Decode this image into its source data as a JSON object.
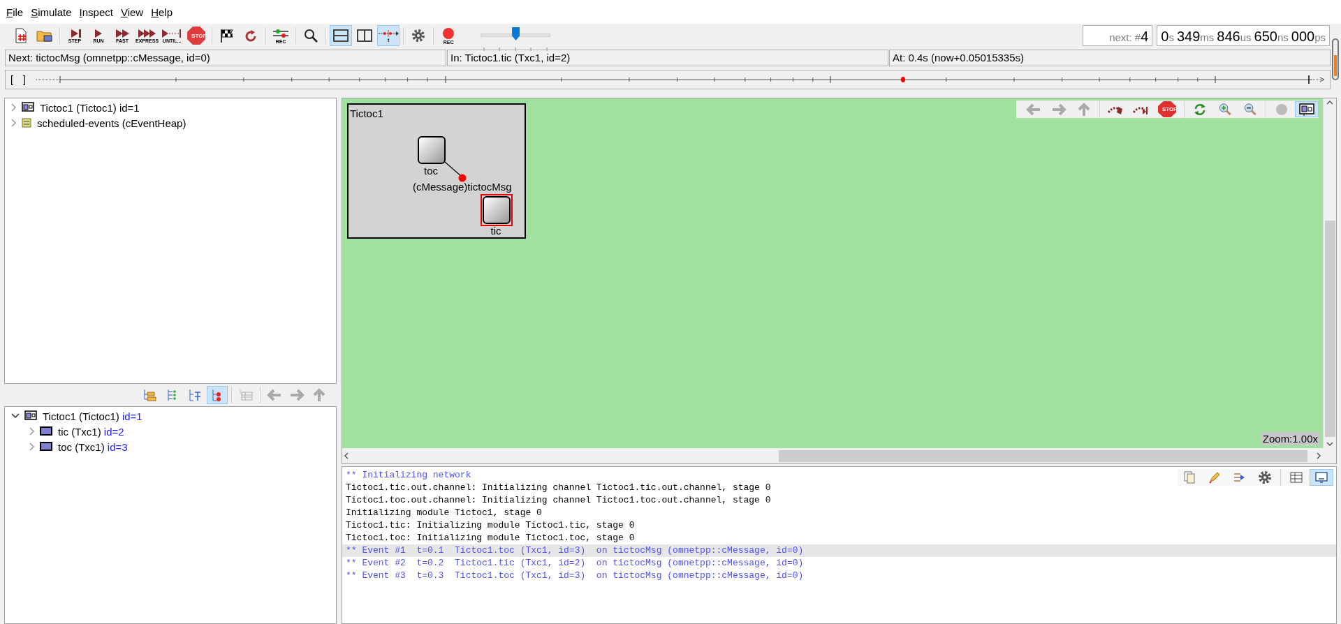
{
  "menu": [
    "File",
    "Simulate",
    "Inspect",
    "View",
    "Help"
  ],
  "toolbar": {
    "groups": [
      [
        {
          "kind": "new",
          "selected": false
        },
        {
          "kind": "open",
          "selected": false
        }
      ],
      [
        {
          "kind": "step",
          "label": "STEP",
          "selected": false
        },
        {
          "kind": "run",
          "label": "RUN",
          "selected": false
        },
        {
          "kind": "fast",
          "label": "FAST",
          "selected": false
        },
        {
          "kind": "express",
          "label": "EXPRESS",
          "selected": false
        },
        {
          "kind": "until",
          "label": "UNTIL...",
          "selected": false
        },
        {
          "kind": "stop",
          "label": "STOP",
          "selected": false
        }
      ],
      [
        {
          "kind": "finish",
          "selected": false
        },
        {
          "kind": "rebuild",
          "selected": false
        }
      ],
      [
        {
          "kind": "eventlog",
          "label": "REC",
          "selected": false
        }
      ],
      [
        {
          "kind": "find",
          "selected": false
        }
      ],
      [
        {
          "kind": "rows",
          "selected": true
        },
        {
          "kind": "cols",
          "selected": false
        },
        {
          "kind": "timeline",
          "label": "t",
          "selected": true
        }
      ],
      [
        {
          "kind": "settings",
          "selected": false
        }
      ],
      [
        {
          "kind": "record",
          "label": "REC",
          "selected": false
        }
      ]
    ],
    "speed_slider": {
      "level": 0.5
    }
  },
  "next_event": {
    "label": "next: #",
    "value": "4"
  },
  "sim_time": [
    {
      "value": "0",
      "unit": "s"
    },
    {
      "value": "349",
      "unit": "ms"
    },
    {
      "value": "846",
      "unit": "us"
    },
    {
      "value": "650",
      "unit": "ns"
    },
    {
      "value": "000",
      "unit": "ps"
    }
  ],
  "status_bar": [
    "Next: tictocMsg (omnetpp::cMessage, id=0)",
    "In: Tictoc1.tic (Txc1, id=2)",
    "At: 0.4s (now+0.05015335s)"
  ],
  "timeline": {
    "open_bracket": "[",
    "close_bracket": "]"
  },
  "object_tree": [
    {
      "kind": "module",
      "label": "Tictoc1 (Tictoc1) id=1",
      "expanded": false
    },
    {
      "kind": "queue",
      "label": "scheduled-events (cEventHeap)",
      "expanded": false
    }
  ],
  "inspector_toolbar": {
    "groups": [
      [
        {
          "kind": "tree-folders",
          "selected": false,
          "disabled": false
        },
        {
          "kind": "tree-dots",
          "selected": false,
          "disabled": false
        },
        {
          "kind": "tree-types",
          "selected": false,
          "disabled": false
        },
        {
          "kind": "tree-red",
          "selected": true,
          "disabled": false
        }
      ],
      [
        {
          "kind": "tree-table",
          "selected": false,
          "disabled": true
        }
      ],
      [
        {
          "kind": "back",
          "selected": false,
          "disabled": true
        },
        {
          "kind": "forward",
          "selected": false,
          "disabled": true
        },
        {
          "kind": "up",
          "selected": false,
          "disabled": true
        }
      ]
    ]
  },
  "module_tree": [
    {
      "kind": "compound",
      "name": "Tictoc1 (Tictoc1)",
      "id": "id=1",
      "expanded": true,
      "children": [
        {
          "kind": "simple",
          "name": "tic (Txc1)",
          "id": "id=2",
          "expanded": false
        },
        {
          "kind": "simple",
          "name": "toc (Txc1)",
          "id": "id=3",
          "expanded": false
        }
      ]
    }
  ],
  "canvas": {
    "module": {
      "title": "Tictoc1",
      "nodes": [
        {
          "name": "toc",
          "highlighted": false
        },
        {
          "name": "tic",
          "highlighted": true
        }
      ],
      "message": {
        "label": "(cMessage)tictocMsg"
      }
    },
    "toolbar": {
      "groups": [
        [
          {
            "kind": "back",
            "selected": false,
            "disabled": true
          },
          {
            "kind": "forward",
            "selected": false,
            "disabled": true
          },
          {
            "kind": "up",
            "selected": false,
            "disabled": true
          }
        ],
        [
          {
            "kind": "arc",
            "selected": false,
            "disabled": false
          },
          {
            "kind": "arc2",
            "selected": false,
            "disabled": false
          },
          {
            "kind": "stop",
            "label": "STOP",
            "selected": false,
            "disabled": false
          }
        ],
        [
          {
            "kind": "refresh",
            "selected": false,
            "disabled": false
          },
          {
            "kind": "zoom-in",
            "selected": false,
            "disabled": false
          },
          {
            "kind": "zoom-out",
            "selected": false,
            "disabled": false
          }
        ],
        [
          {
            "kind": "ball",
            "selected": false,
            "disabled": false
          },
          {
            "kind": "module",
            "selected": true,
            "disabled": false
          }
        ]
      ]
    },
    "zoom": "Zoom:1.00x"
  },
  "log": {
    "toolbar": {
      "groups": [
        [
          {
            "kind": "copy",
            "selected": false
          },
          {
            "kind": "highlight",
            "selected": false
          },
          {
            "kind": "filter",
            "selected": false
          },
          {
            "kind": "settings",
            "selected": false
          }
        ],
        [
          {
            "kind": "table",
            "selected": false
          },
          {
            "kind": "screen",
            "selected": true
          }
        ]
      ]
    },
    "lines": [
      {
        "kind": "info",
        "text": "** Initializing network",
        "selected": false
      },
      {
        "kind": "plain",
        "text": "Tictoc1.tic.out.channel: Initializing channel Tictoc1.tic.out.channel, stage 0",
        "selected": false
      },
      {
        "kind": "plain",
        "text": "Tictoc1.toc.out.channel: Initializing channel Tictoc1.toc.out.channel, stage 0",
        "selected": false
      },
      {
        "kind": "plain",
        "text": "Initializing module Tictoc1, stage 0",
        "selected": false
      },
      {
        "kind": "plain",
        "text": "Tictoc1.tic: Initializing module Tictoc1.tic, stage 0",
        "selected": false
      },
      {
        "kind": "plain",
        "text": "Tictoc1.toc: Initializing module Tictoc1.toc, stage 0",
        "selected": false
      },
      {
        "kind": "info",
        "text": "** Event #1  t=0.1  Tictoc1.toc (Txc1, id=3)  on tictocMsg (omnetpp::cMessage, id=0)",
        "selected": true
      },
      {
        "kind": "info",
        "text": "** Event #2  t=0.2  Tictoc1.tic (Txc1, id=2)  on tictocMsg (omnetpp::cMessage, id=0)",
        "selected": false
      },
      {
        "kind": "info",
        "text": "** Event #3  t=0.3  Tictoc1.toc (Txc1, id=3)  on tictocMsg (omnetpp::cMessage, id=0)",
        "selected": false
      }
    ]
  }
}
